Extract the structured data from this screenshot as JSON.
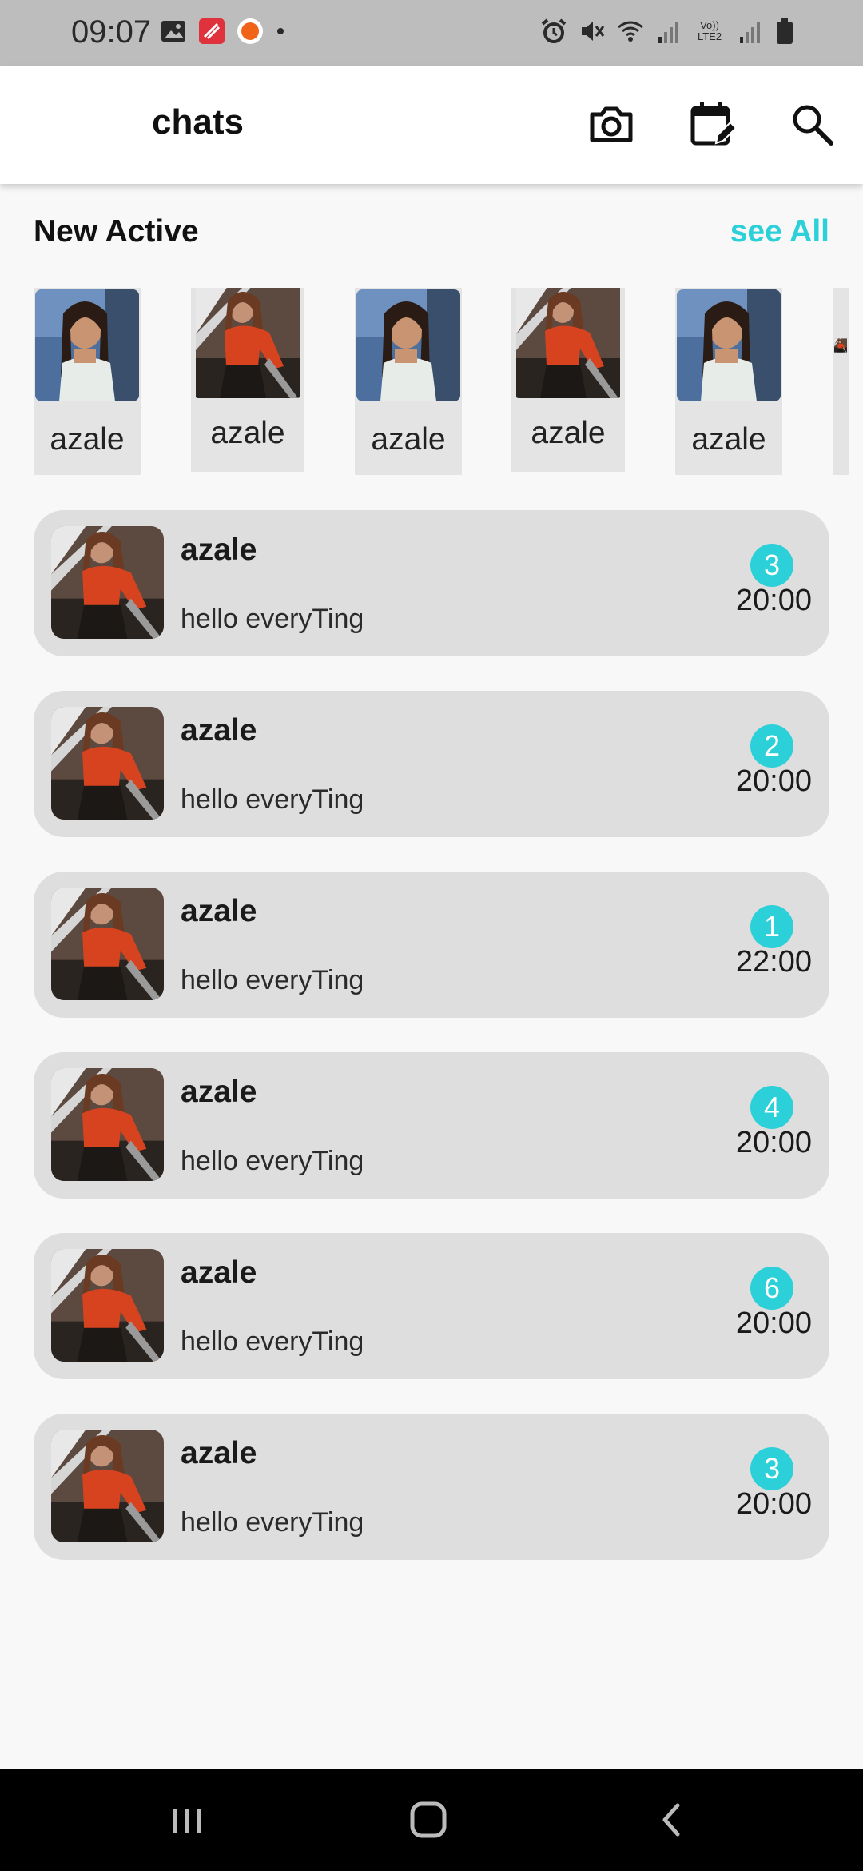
{
  "status_bar": {
    "time": "09:07",
    "left_icons": [
      "image-icon",
      "app-notification-icon",
      "orange-app-icon",
      "dot-icon"
    ],
    "right_icons": [
      "alarm-icon",
      "mute-icon",
      "wifi-icon",
      "signal-icon",
      "volte-icon",
      "signal-icon",
      "battery-icon"
    ],
    "volte_label": "Vo)) LTE2"
  },
  "app_bar": {
    "title": "chats",
    "actions": [
      "camera-icon",
      "calendar-edit-icon",
      "search-icon"
    ]
  },
  "active_section": {
    "title": "New Active",
    "see_all": "see All",
    "stories": [
      {
        "label": "azale",
        "avatar": "photo-white-top"
      },
      {
        "label": "azale",
        "avatar": "photo-red-top"
      },
      {
        "label": "azale",
        "avatar": "photo-white-top"
      },
      {
        "label": "azale",
        "avatar": "photo-red-top"
      },
      {
        "label": "azale",
        "avatar": "photo-white-top"
      }
    ]
  },
  "chats": [
    {
      "name": "azale",
      "message": "hello everyTing",
      "unread": "3",
      "time": "20:00"
    },
    {
      "name": "azale",
      "message": "hello everyTing",
      "unread": "2",
      "time": "20:00"
    },
    {
      "name": "azale",
      "message": "hello everyTing",
      "unread": "1",
      "time": "22:00"
    },
    {
      "name": "azale",
      "message": "hello everyTing",
      "unread": "4",
      "time": "20:00"
    },
    {
      "name": "azale",
      "message": "hello everyTing",
      "unread": "6",
      "time": "20:00"
    },
    {
      "name": "azale",
      "message": "hello everyTing",
      "unread": "3",
      "time": "20:00"
    }
  ],
  "nav_bar": {
    "buttons": [
      "recent-apps-icon",
      "home-icon",
      "back-icon"
    ]
  },
  "colors": {
    "accent": "#2bd0d8",
    "chat_card": "#dedede",
    "status_bar": "#bdbdbd"
  }
}
